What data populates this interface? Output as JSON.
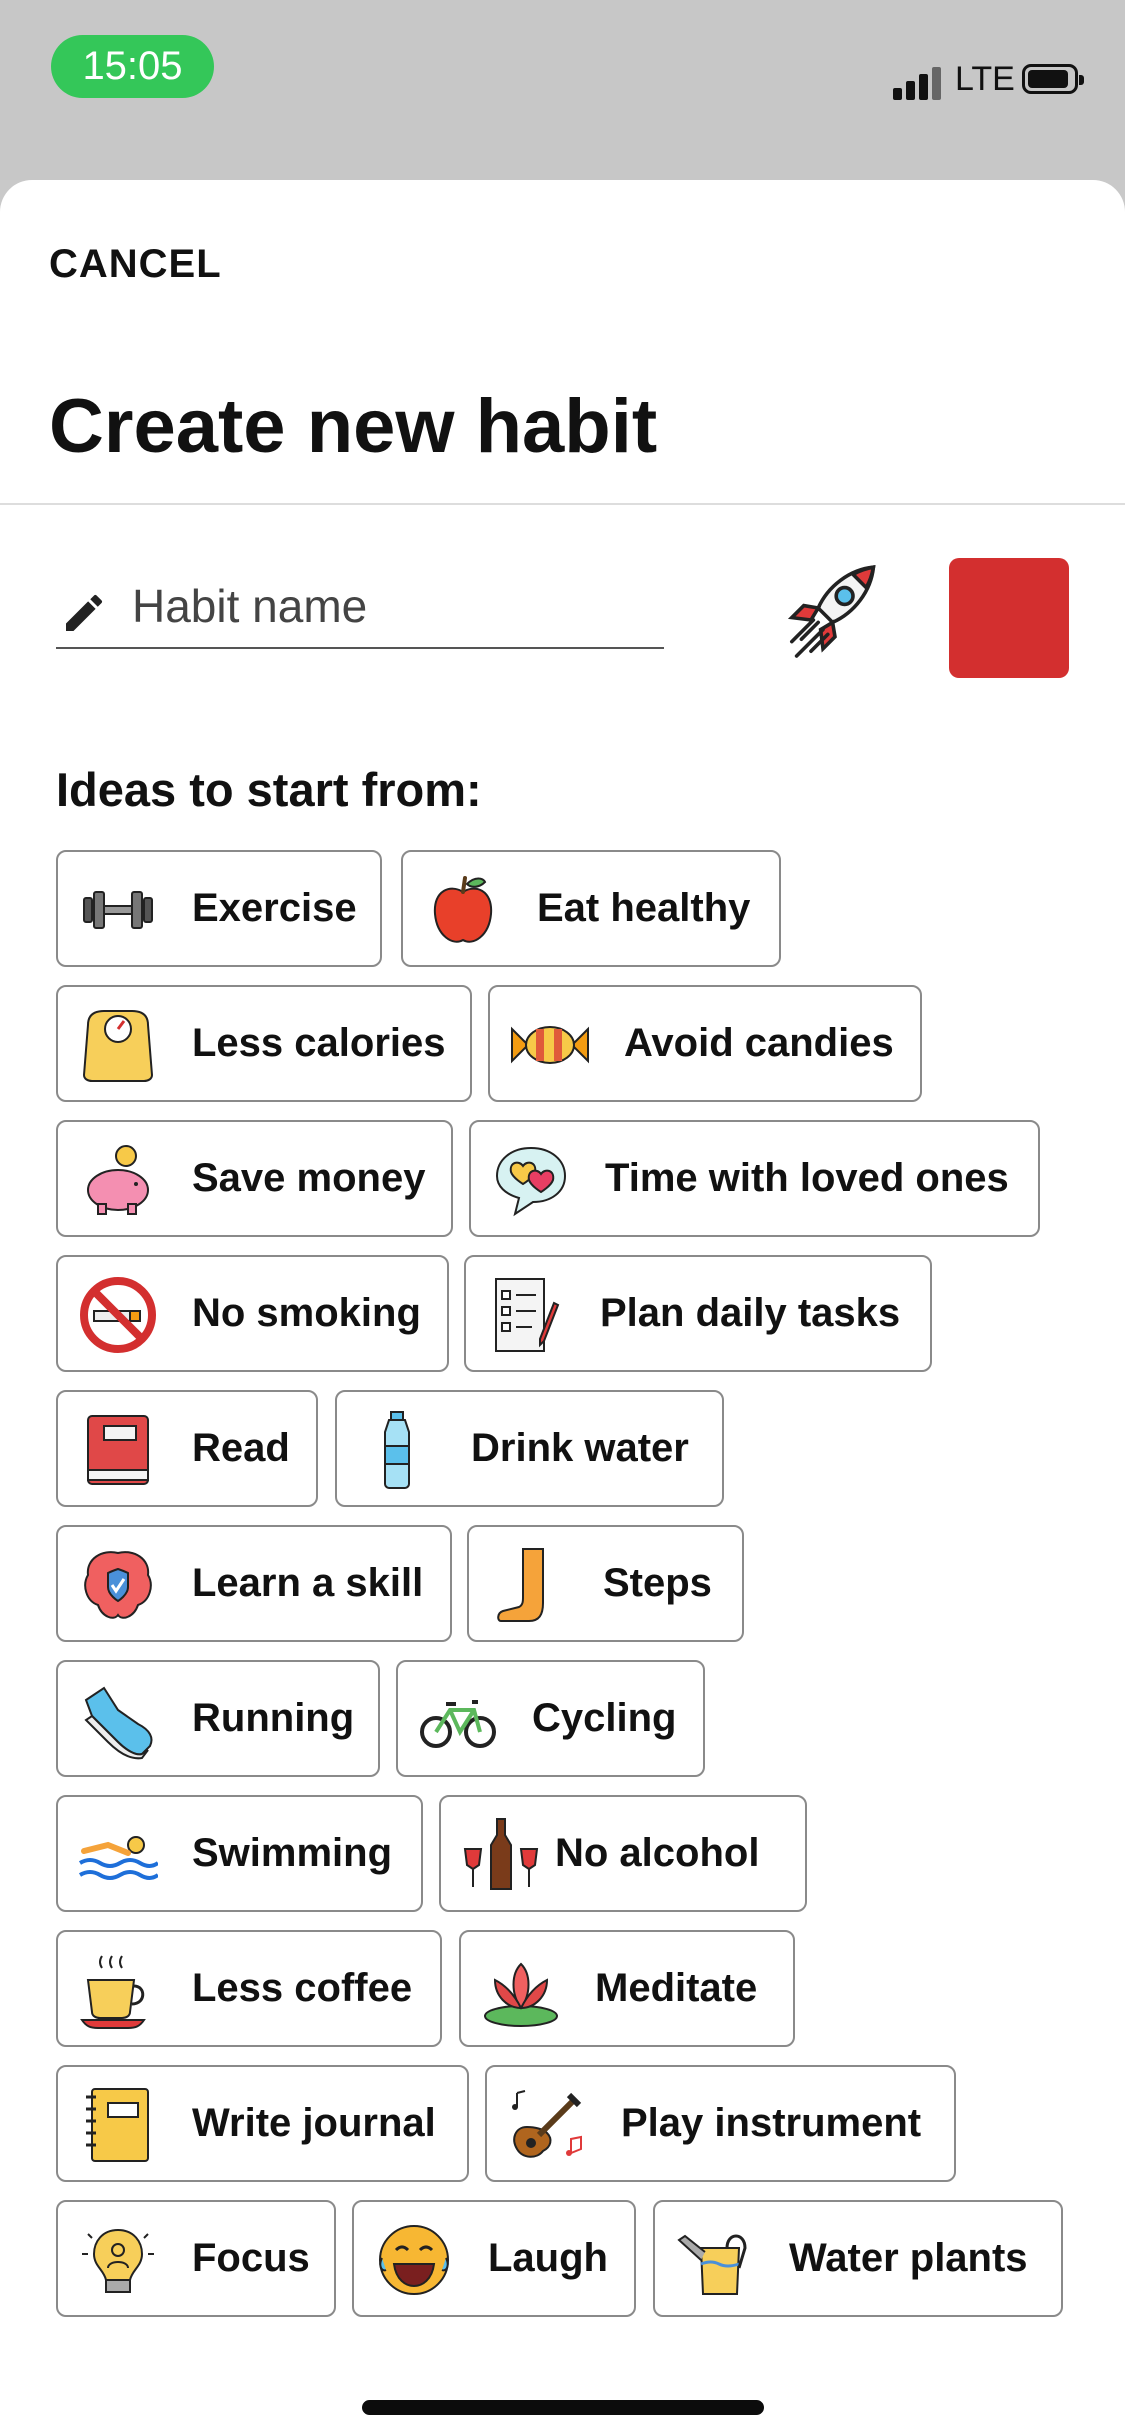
{
  "status_bar": {
    "time": "15:05",
    "network": "LTE"
  },
  "header": {
    "cancel_label": "CANCEL",
    "title": "Create new habit"
  },
  "form": {
    "name_placeholder": "Habit name",
    "selected_icon": "rocket-icon",
    "selected_color": "#d32f2f"
  },
  "ideas": {
    "heading": "Ideas to start from:",
    "items": [
      {
        "label": "Exercise",
        "icon": "dumbbell-icon"
      },
      {
        "label": "Eat healthy",
        "icon": "apple-icon"
      },
      {
        "label": "Less calories",
        "icon": "scale-icon"
      },
      {
        "label": "Avoid candies",
        "icon": "candy-icon"
      },
      {
        "label": "Save money",
        "icon": "piggy-bank-icon"
      },
      {
        "label": "Time with loved ones",
        "icon": "hearts-bubble-icon"
      },
      {
        "label": "No smoking",
        "icon": "no-smoking-icon"
      },
      {
        "label": "Plan daily tasks",
        "icon": "checklist-icon"
      },
      {
        "label": "Read",
        "icon": "book-icon"
      },
      {
        "label": "Drink water",
        "icon": "water-bottle-icon"
      },
      {
        "label": "Learn a skill",
        "icon": "brain-icon"
      },
      {
        "label": "Steps",
        "icon": "foot-icon"
      },
      {
        "label": "Running",
        "icon": "sneaker-icon"
      },
      {
        "label": "Cycling",
        "icon": "bicycle-icon"
      },
      {
        "label": "Swimming",
        "icon": "swimmer-icon"
      },
      {
        "label": "No alcohol",
        "icon": "wine-icon"
      },
      {
        "label": "Less coffee",
        "icon": "coffee-cup-icon"
      },
      {
        "label": "Meditate",
        "icon": "lotus-icon"
      },
      {
        "label": "Write journal",
        "icon": "journal-icon"
      },
      {
        "label": "Play instrument",
        "icon": "guitar-icon"
      },
      {
        "label": "Focus",
        "icon": "lightbulb-icon"
      },
      {
        "label": "Laugh",
        "icon": "laughing-face-icon"
      },
      {
        "label": "Water plants",
        "icon": "watering-can-icon"
      }
    ]
  }
}
